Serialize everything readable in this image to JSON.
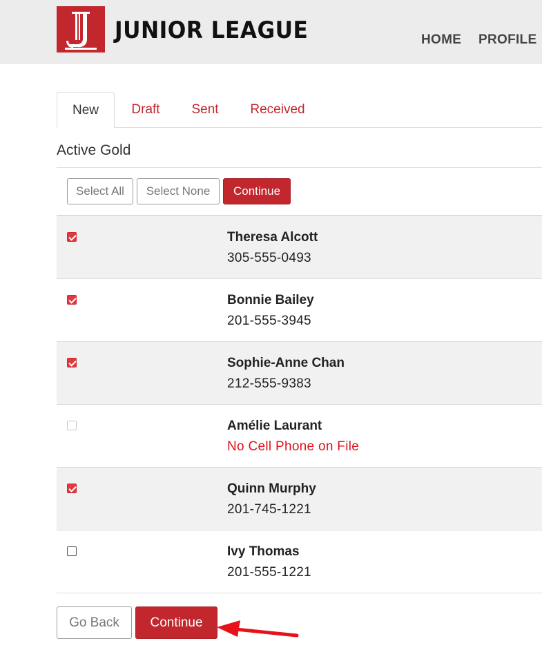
{
  "header": {
    "brand": "JUNIOR LEAGUE",
    "logo_icon": "junior-league-logo-icon",
    "brand_color": "#c1272d",
    "nav": {
      "home": "HOME",
      "profile": "PROFILE"
    }
  },
  "tabs": {
    "new": "New",
    "draft": "Draft",
    "sent": "Sent",
    "received": "Received",
    "active": "New"
  },
  "section": {
    "title": "Active Gold"
  },
  "toolbar": {
    "select_all": "Select All",
    "select_none": "Select None",
    "continue": "Continue"
  },
  "members": [
    {
      "name": "Theresa Alcott",
      "phone": "305-555-0493",
      "checked": true,
      "enabled": true
    },
    {
      "name": "Bonnie Bailey",
      "phone": "201-555-3945",
      "checked": true,
      "enabled": true
    },
    {
      "name": "Sophie-Anne Chan",
      "phone": "212-555-9383",
      "checked": true,
      "enabled": true
    },
    {
      "name": "Amélie Laurant",
      "phone": "No Cell Phone on File",
      "checked": false,
      "enabled": false
    },
    {
      "name": "Quinn Murphy",
      "phone": "201-745-1221",
      "checked": true,
      "enabled": true
    },
    {
      "name": "Ivy Thomas",
      "phone": "201-555-1221",
      "checked": false,
      "enabled": true
    }
  ],
  "footer": {
    "go_back": "Go Back",
    "continue": "Continue"
  },
  "annotation": {
    "arrow_color": "#e8101a"
  }
}
